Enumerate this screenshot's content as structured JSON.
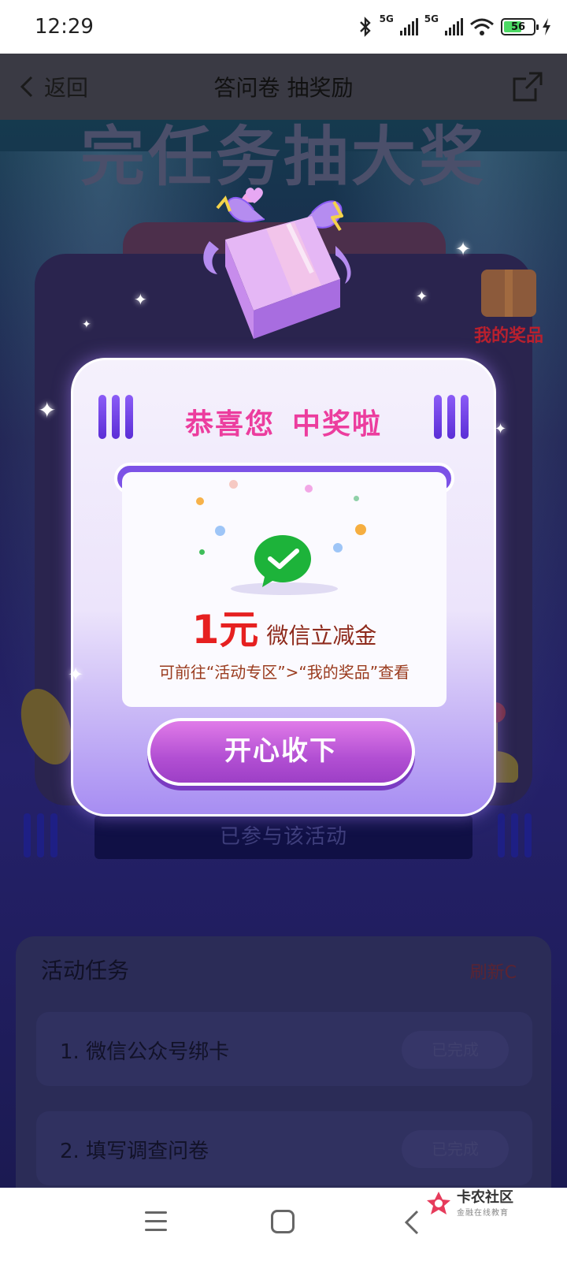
{
  "status_bar": {
    "time": "12:29",
    "network_1": "5G",
    "network_2": "5G",
    "battery": "56"
  },
  "nav": {
    "back_label": "返回",
    "title": "答问卷 抽奖励"
  },
  "background": {
    "banner_title": "完任务抽大奖",
    "my_prize_label": "我的奖品",
    "joined_label": "已参与该活动",
    "tasks_title": "活动任务",
    "refresh_label": "刷新C",
    "tasks": [
      {
        "label": "1. 微信公众号绑卡",
        "status": "已完成"
      },
      {
        "label": "2. 填写调查问卷",
        "status": "已完成"
      }
    ]
  },
  "modal": {
    "title_part1": "恭喜您",
    "title_part2": "中奖啦",
    "prize_amount": "1元",
    "prize_type": "微信立减金",
    "prize_hint": "可前往“活动专区”>“我的奖品”查看",
    "accept_label": "开心收下"
  },
  "watermark": {
    "name": "卡农社区",
    "tagline": "金融在线教育"
  },
  "colors": {
    "title_pink": "#ec3d9e",
    "amount_red": "#e62020",
    "wechat_green": "#1db33a",
    "button_purple": "#b24fd3"
  }
}
